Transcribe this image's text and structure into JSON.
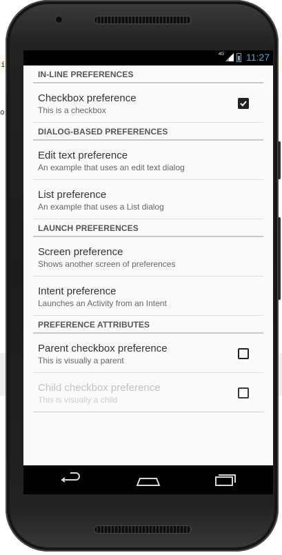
{
  "background": {
    "left_glyph_top": "i",
    "left_glyph_mid": "o"
  },
  "status": {
    "network": "4G",
    "time": "11:27",
    "accent": "#33b5e5"
  },
  "sections": [
    {
      "header": "IN-LINE PREFERENCES",
      "items": [
        {
          "title": "Checkbox preference",
          "summary": "This is a checkbox",
          "checkbox": true,
          "checked": true,
          "enabled": true
        }
      ]
    },
    {
      "header": "DIALOG-BASED PREFERENCES",
      "items": [
        {
          "title": "Edit text preference",
          "summary": "An example that uses an edit text dialog",
          "checkbox": false,
          "enabled": true
        },
        {
          "title": "List preference",
          "summary": "An example that uses a List dialog",
          "checkbox": false,
          "enabled": true
        }
      ]
    },
    {
      "header": "LAUNCH PREFERENCES",
      "items": [
        {
          "title": "Screen preference",
          "summary": "Shows another screen of preferences",
          "checkbox": false,
          "enabled": true
        },
        {
          "title": "Intent preference",
          "summary": "Launches an Activity from an Intent",
          "checkbox": false,
          "enabled": true
        }
      ]
    },
    {
      "header": "PREFERENCE ATTRIBUTES",
      "items": [
        {
          "title": "Parent checkbox preference",
          "summary": "This is visually a parent",
          "checkbox": true,
          "checked": false,
          "enabled": true
        },
        {
          "title": "Child checkbox preference",
          "summary": "This is visually a child",
          "checkbox": true,
          "checked": false,
          "enabled": false
        }
      ]
    }
  ],
  "navbar": {
    "icons": [
      "back-icon",
      "home-icon",
      "recents-icon"
    ]
  }
}
